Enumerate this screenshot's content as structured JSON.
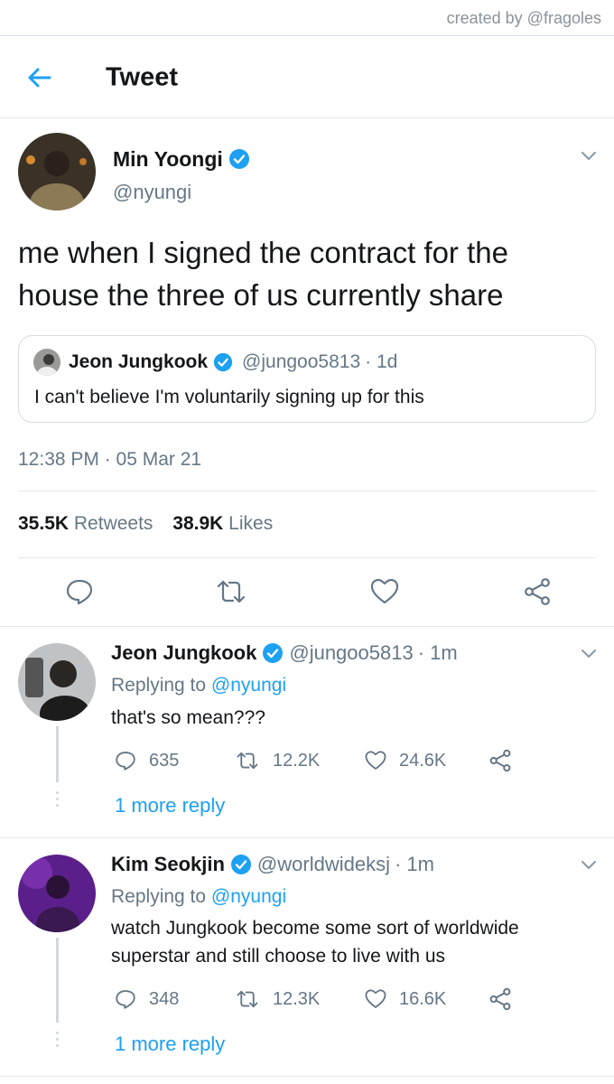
{
  "credit": "created by @fragoles",
  "header": {
    "title": "Tweet"
  },
  "main_tweet": {
    "name": "Min Yoongi",
    "handle": "@nyungi",
    "text": "me when I signed the contract for the house the three of us currently share",
    "quote": {
      "name": "Jeon Jungkook",
      "handle": "@jungoo5813",
      "age": "· 1d",
      "text": "I can't believe I'm voluntarily signing up for this"
    },
    "time": "12:38 PM",
    "date": "· 05 Mar 21",
    "retweets": "35.5K",
    "retweets_label": "Retweets",
    "likes": "38.9K",
    "likes_label": "Likes"
  },
  "replies": [
    {
      "name": "Jeon Jungkook",
      "handle": "@jungoo5813",
      "age": "· 1m",
      "replying_prefix": "Replying to",
      "replying_to": "@nyungi",
      "text": "that's so mean???",
      "comments": "635",
      "retweets": "12.2K",
      "likes": "24.6K",
      "more": "1 more reply"
    },
    {
      "name": "Kim Seokjin",
      "handle": "@worldwideksj",
      "age": "· 1m",
      "replying_prefix": "Replying to",
      "replying_to": "@nyungi",
      "text": "watch Jungkook become some sort of worldwide superstar and still choose to live with us",
      "comments": "348",
      "retweets": "12.3K",
      "likes": "16.6K",
      "more": "1 more reply"
    }
  ],
  "colors": {
    "accent": "#1da1f2",
    "secondary_text": "#657786",
    "verified": "#1da1f2"
  },
  "icons": [
    "back-arrow-icon",
    "verified-icon",
    "chevron-down-icon",
    "reply-icon",
    "retweet-icon",
    "like-icon",
    "share-icon"
  ]
}
